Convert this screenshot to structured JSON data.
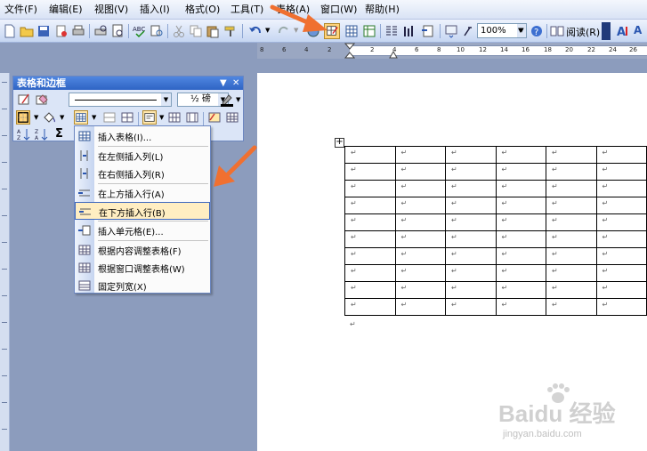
{
  "menubar": {
    "items": [
      "文件(F)",
      "编辑(E)",
      "视图(V)",
      "插入(I)",
      "格式(O)",
      "工具(T)",
      "表格(A)",
      "窗口(W)",
      "帮助(H)"
    ]
  },
  "toolbar": {
    "zoom": "100%",
    "read_label": "阅读(R)"
  },
  "ruler": {
    "numbers": [
      "8",
      "6",
      "4",
      "2",
      "2",
      "4",
      "6",
      "8",
      "10",
      "12",
      "14",
      "16",
      "18",
      "20",
      "22",
      "24",
      "26"
    ]
  },
  "panel": {
    "title": "表格和边框",
    "weight": "½ 磅"
  },
  "dropdown": {
    "items": [
      "插入表格(I)...",
      "在左侧插入列(L)",
      "在右侧插入列(R)",
      "在上方插入行(A)",
      "在下方插入行(B)",
      "插入单元格(E)...",
      "根据内容调整表格(F)",
      "根据窗口调整表格(W)",
      "固定列宽(X)"
    ],
    "highlighted": "在下方插入行(B)"
  },
  "document": {
    "cell_mark": "↵",
    "table_handle": "+"
  },
  "watermark": {
    "text": "Baidu 经验",
    "sub": "jingyan.baidu.com"
  },
  "colors": {
    "arrow": "#f07030",
    "highlight": "#ffeec2",
    "panel_title": "#2f64c4"
  }
}
